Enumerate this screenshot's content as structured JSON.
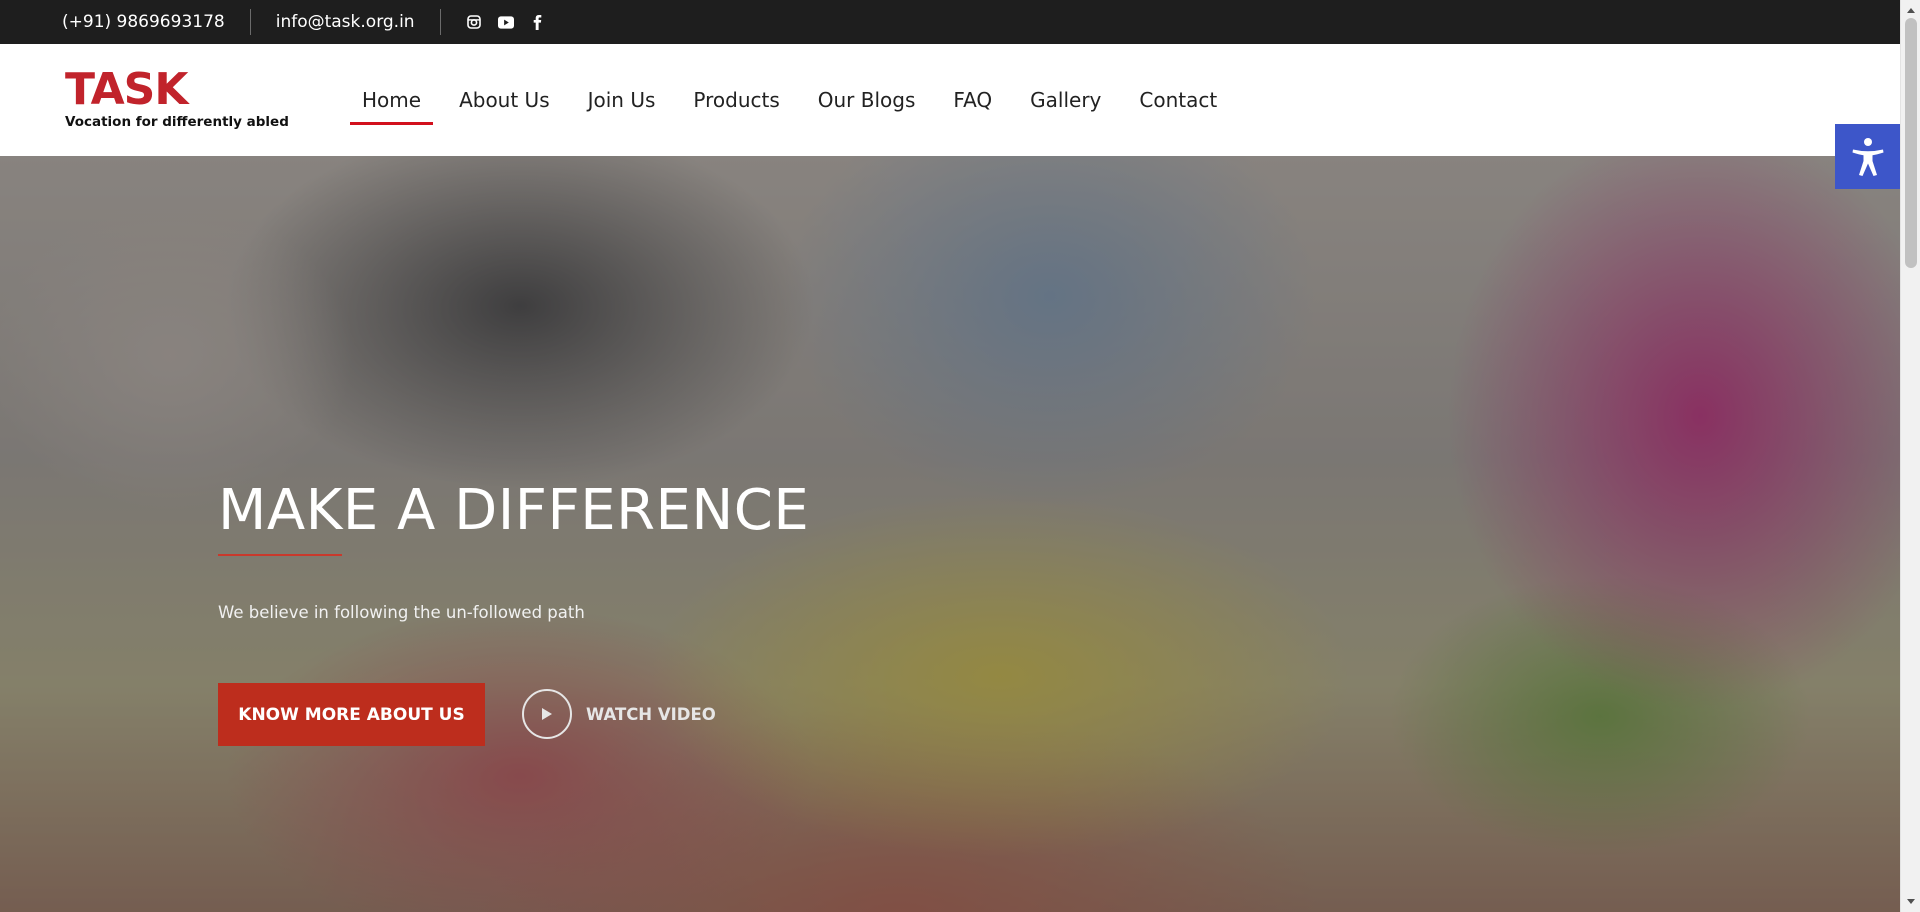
{
  "topbar": {
    "phone": "(+91) 9869693178",
    "email": "info@task.org.in",
    "social": [
      "instagram-icon",
      "youtube-icon",
      "facebook-icon"
    ]
  },
  "logo": {
    "brand": "TASK",
    "tagline": "Vocation for differently abled"
  },
  "nav": {
    "items": [
      {
        "label": "Home",
        "active": true
      },
      {
        "label": "About Us"
      },
      {
        "label": "Join Us"
      },
      {
        "label": "Products"
      },
      {
        "label": "Our Blogs"
      },
      {
        "label": "FAQ"
      },
      {
        "label": "Gallery"
      },
      {
        "label": "Contact"
      }
    ]
  },
  "hero": {
    "title": "MAKE A DIFFERENCE",
    "subtitle": "We believe in following the un-followed path",
    "cta_label": "KNOW MORE ABOUT US",
    "watch_label": "WATCH VIDEO"
  },
  "accessibility": {
    "icon": "accessibility-icon"
  },
  "colors": {
    "brand_red": "#c1232b",
    "nav_active_underline": "#d2101d",
    "cta_background": "#bd2d1d",
    "topbar_background": "#1e1e1e",
    "accessibility_background": "#3d56c9"
  }
}
